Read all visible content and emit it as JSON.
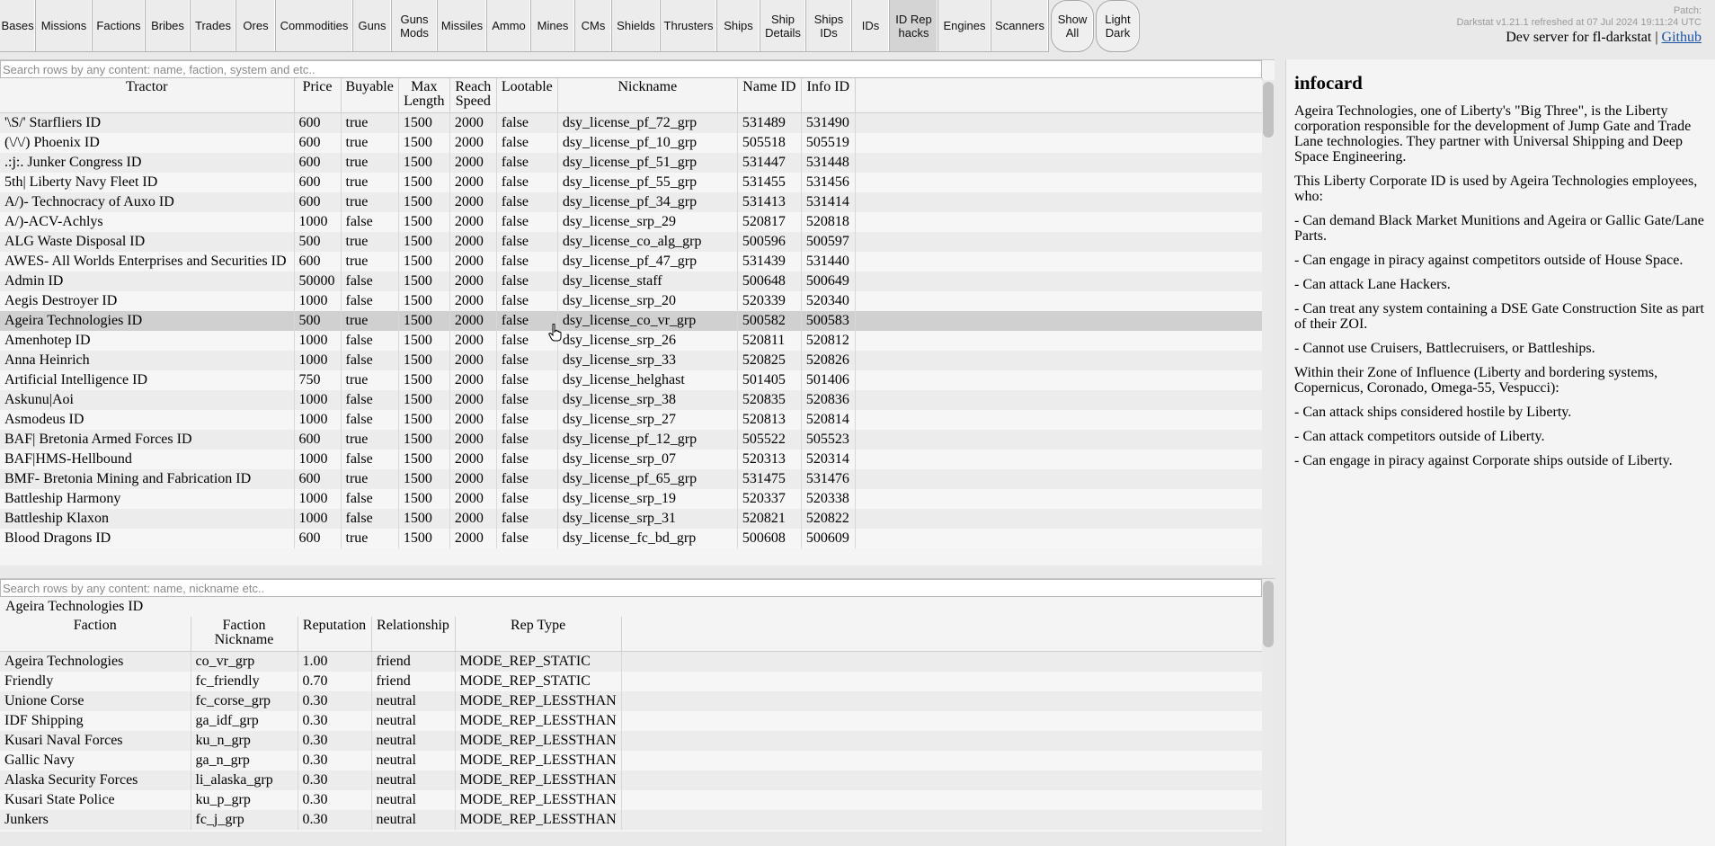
{
  "nav": {
    "tabs": [
      {
        "label": "Bases",
        "w": 40
      },
      {
        "label": "Missions",
        "w": 63
      },
      {
        "label": "Factions",
        "w": 59
      },
      {
        "label": "Bribes",
        "w": 50
      },
      {
        "label": "Trades",
        "w": 51
      },
      {
        "label": "Ores",
        "w": 44
      },
      {
        "label": "Commodities",
        "w": 86
      },
      {
        "label": "Guns",
        "w": 43
      },
      {
        "label": "Guns\nMods",
        "w": 51
      },
      {
        "label": "Missiles",
        "w": 55
      },
      {
        "label": "Ammo",
        "w": 49
      },
      {
        "label": "Mines",
        "w": 49
      },
      {
        "label": "CMs",
        "w": 41
      },
      {
        "label": "Shields",
        "w": 54
      },
      {
        "label": "Thrusters",
        "w": 63
      },
      {
        "label": "Ships",
        "w": 48
      },
      {
        "label": "Ship\nDetails",
        "w": 51
      },
      {
        "label": "Ships\nIDs",
        "w": 51
      },
      {
        "label": "IDs",
        "w": 42
      },
      {
        "label": "ID Rep\nhacks",
        "w": 54,
        "active": true
      },
      {
        "label": "Engines",
        "w": 59
      },
      {
        "label": "Scanners",
        "w": 64
      },
      {
        "label": "Show\nAll",
        "w": 48,
        "round": true
      },
      {
        "label": "Light\nDark",
        "w": 49,
        "round": true
      }
    ],
    "patch": "Patch:",
    "version": "Darkstat v1.21.1 refreshed at 07 Jul 2024 19:11:24 UTC",
    "dev_text": "Dev server for fl-darkstat | ",
    "github": "Github"
  },
  "top": {
    "search_placeholder": "Search rows by any content: name, faction, system and etc..",
    "headers": [
      "Tractor",
      "Price",
      "Buyable",
      "Max\nLength",
      "Reach\nSpeed",
      "Lootable",
      "Nickname",
      "Name ID",
      "Info ID"
    ],
    "rows": [
      [
        "'\\S/' Starfliers ID",
        "600",
        "true",
        "1500",
        "2000",
        "false",
        "dsy_license_pf_72_grp",
        "531489",
        "531490"
      ],
      [
        "(\\/\\/) Phoenix ID",
        "600",
        "true",
        "1500",
        "2000",
        "false",
        "dsy_license_pf_10_grp",
        "505518",
        "505519"
      ],
      [
        ".:j:. Junker Congress ID",
        "600",
        "true",
        "1500",
        "2000",
        "false",
        "dsy_license_pf_51_grp",
        "531447",
        "531448"
      ],
      [
        "5th| Liberty Navy Fleet ID",
        "600",
        "true",
        "1500",
        "2000",
        "false",
        "dsy_license_pf_55_grp",
        "531455",
        "531456"
      ],
      [
        "A/)- Technocracy of Auxo ID",
        "600",
        "true",
        "1500",
        "2000",
        "false",
        "dsy_license_pf_34_grp",
        "531413",
        "531414"
      ],
      [
        "A/)-ACV-Achlys",
        "1000",
        "false",
        "1500",
        "2000",
        "false",
        "dsy_license_srp_29",
        "520817",
        "520818"
      ],
      [
        "ALG Waste Disposal ID",
        "500",
        "true",
        "1500",
        "2000",
        "false",
        "dsy_license_co_alg_grp",
        "500596",
        "500597"
      ],
      [
        "AWES- All Worlds Enterprises and Securities ID",
        "600",
        "true",
        "1500",
        "2000",
        "false",
        "dsy_license_pf_47_grp",
        "531439",
        "531440"
      ],
      [
        "Admin ID",
        "50000",
        "false",
        "1500",
        "2000",
        "false",
        "dsy_license_staff",
        "500648",
        "500649"
      ],
      [
        "Aegis Destroyer ID",
        "1000",
        "false",
        "1500",
        "2000",
        "false",
        "dsy_license_srp_20",
        "520339",
        "520340"
      ],
      [
        "Ageira Technologies ID",
        "500",
        "true",
        "1500",
        "2000",
        "false",
        "dsy_license_co_vr_grp",
        "500582",
        "500583"
      ],
      [
        "Amenhotep ID",
        "1000",
        "false",
        "1500",
        "2000",
        "false",
        "dsy_license_srp_26",
        "520811",
        "520812"
      ],
      [
        "Anna Heinrich",
        "1000",
        "false",
        "1500",
        "2000",
        "false",
        "dsy_license_srp_33",
        "520825",
        "520826"
      ],
      [
        "Artificial Intelligence ID",
        "750",
        "true",
        "1500",
        "2000",
        "false",
        "dsy_license_helghast",
        "501405",
        "501406"
      ],
      [
        "Askunu|Aoi",
        "1000",
        "false",
        "1500",
        "2000",
        "false",
        "dsy_license_srp_38",
        "520835",
        "520836"
      ],
      [
        "Asmodeus ID",
        "1000",
        "false",
        "1500",
        "2000",
        "false",
        "dsy_license_srp_27",
        "520813",
        "520814"
      ],
      [
        "BAF| Bretonia Armed Forces ID",
        "600",
        "true",
        "1500",
        "2000",
        "false",
        "dsy_license_pf_12_grp",
        "505522",
        "505523"
      ],
      [
        "BAF|HMS-Hellbound",
        "1000",
        "false",
        "1500",
        "2000",
        "false",
        "dsy_license_srp_07",
        "520313",
        "520314"
      ],
      [
        "BMF- Bretonia Mining and Fabrication ID",
        "600",
        "true",
        "1500",
        "2000",
        "false",
        "dsy_license_pf_65_grp",
        "531475",
        "531476"
      ],
      [
        "Battleship Harmony",
        "1000",
        "false",
        "1500",
        "2000",
        "false",
        "dsy_license_srp_19",
        "520337",
        "520338"
      ],
      [
        "Battleship Klaxon",
        "1000",
        "false",
        "1500",
        "2000",
        "false",
        "dsy_license_srp_31",
        "520821",
        "520822"
      ],
      [
        "Blood Dragons ID",
        "600",
        "true",
        "1500",
        "2000",
        "false",
        "dsy_license_fc_bd_grp",
        "500608",
        "500609"
      ]
    ],
    "selected_index": 10
  },
  "bottom": {
    "search_placeholder": "Search rows by any content: name, nickname etc..",
    "title": "Ageira Technologies ID",
    "headers": [
      "Faction",
      "Faction\nNickname",
      "Reputation",
      "Relationship",
      "Rep Type"
    ],
    "rows": [
      [
        "Ageira Technologies",
        "co_vr_grp",
        "1.00",
        "friend",
        "MODE_REP_STATIC"
      ],
      [
        "Friendly",
        "fc_friendly",
        "0.70",
        "friend",
        "MODE_REP_STATIC"
      ],
      [
        "Unione Corse",
        "fc_corse_grp",
        "0.30",
        "neutral",
        "MODE_REP_LESSTHAN"
      ],
      [
        "IDF Shipping",
        "ga_idf_grp",
        "0.30",
        "neutral",
        "MODE_REP_LESSTHAN"
      ],
      [
        "Kusari Naval Forces",
        "ku_n_grp",
        "0.30",
        "neutral",
        "MODE_REP_LESSTHAN"
      ],
      [
        "Gallic Navy",
        "ga_n_grp",
        "0.30",
        "neutral",
        "MODE_REP_LESSTHAN"
      ],
      [
        "Alaska Security Forces",
        "li_alaska_grp",
        "0.30",
        "neutral",
        "MODE_REP_LESSTHAN"
      ],
      [
        "Kusari State Police",
        "ku_p_grp",
        "0.30",
        "neutral",
        "MODE_REP_LESSTHAN"
      ],
      [
        "Junkers",
        "fc_j_grp",
        "0.30",
        "neutral",
        "MODE_REP_LESSTHAN"
      ]
    ]
  },
  "infocard": {
    "title": "infocard",
    "paragraphs": [
      "Ageira Technologies, one of Liberty's \"Big Three\", is the Liberty corporation responsible for the development of Jump Gate and Trade Lane technologies. They partner with Universal Shipping and Deep Space Engineering.",
      "This Liberty Corporate ID is used by Ageira Technologies employees, who:",
      "- Can demand Black Market Munitions and Ageira or Gallic Gate/Lane Parts.",
      "- Can engage in piracy against competitors outside of House Space.",
      "- Can attack Lane Hackers.",
      "- Can treat any system containing a DSE Gate Construction Site as part of their ZOI.",
      "- Cannot use Cruisers, Battlecruisers, or Battleships.",
      "Within their Zone of Influence (Liberty and bordering systems, Copernicus, Coronado, Omega-55, Vespucci):",
      "- Can attack ships considered hostile by Liberty.",
      "- Can attack competitors outside of Liberty.",
      "- Can engage in piracy against Corporate ships outside of Liberty."
    ]
  },
  "colors": {
    "background": "#e9e9e9",
    "selected_row": "#d0d0d0",
    "link": "#1a52a8"
  }
}
